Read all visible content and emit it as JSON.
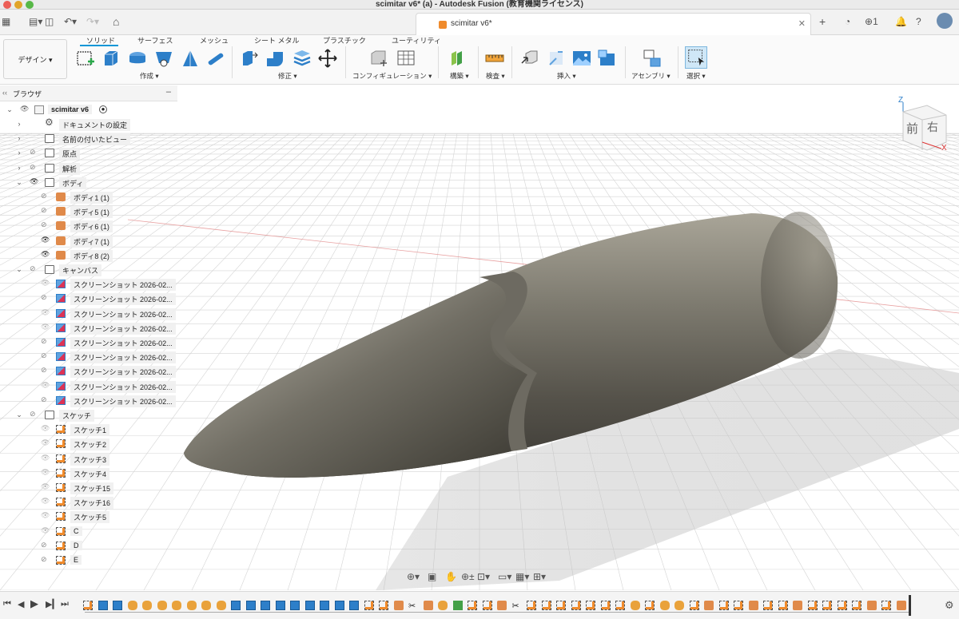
{
  "window": {
    "title": "scimitar v6* (a) - Autodesk Fusion (教育機関ライセンス)",
    "traffic_colors": [
      "#ec5f57",
      "#e1a42a",
      "#57b847"
    ]
  },
  "tabbar": {
    "doc_tab": "scimitar v6*",
    "notifications": "1"
  },
  "toolbar": {
    "workspace": "デザイン ▾",
    "tabs": [
      "ソリッド",
      "サーフェス",
      "メッシュ",
      "シート メタル",
      "プラスチック",
      "ユーティリティ"
    ],
    "groups": {
      "create": "作成 ▾",
      "modify": "修正 ▾",
      "configuration": "コンフィギュレーション ▾",
      "construct": "構築 ▾",
      "inspect": "検査 ▾",
      "insert": "挿入 ▾",
      "assemble": "アセンブリ ▾",
      "select": "選択 ▾"
    }
  },
  "browser": {
    "title": "ブラウザ",
    "root": "scimitar v6",
    "items": [
      {
        "label": "ドキュメントの設定",
        "indent": 1,
        "arrow": "›",
        "icon": "gear"
      },
      {
        "label": "名前の付いたビュー",
        "indent": 1,
        "arrow": "›",
        "icon": "folder"
      },
      {
        "label": "原点",
        "indent": 1,
        "arrow": "›",
        "icon": "folder",
        "eye": "hidden"
      },
      {
        "label": "解析",
        "indent": 1,
        "arrow": "›",
        "icon": "folder",
        "eye": "hidden"
      },
      {
        "label": "ボディ",
        "indent": 1,
        "arrow": "⌄",
        "icon": "folder",
        "eye": "visible"
      },
      {
        "label": "ボディ1 (1)",
        "indent": 2,
        "icon": "body",
        "eye": "hidden"
      },
      {
        "label": "ボディ5 (1)",
        "indent": 2,
        "icon": "body",
        "eye": "hidden"
      },
      {
        "label": "ボディ6 (1)",
        "indent": 2,
        "icon": "body",
        "eye": "hidden"
      },
      {
        "label": "ボディ7 (1)",
        "indent": 2,
        "icon": "body",
        "eye": "visible"
      },
      {
        "label": "ボディ8 (2)",
        "indent": 2,
        "icon": "body",
        "eye": "visible"
      },
      {
        "label": "キャンバス",
        "indent": 1,
        "arrow": "⌄",
        "icon": "folder",
        "eye": "hidden"
      },
      {
        "label": "スクリーンショット 2026-02...",
        "indent": 2,
        "icon": "canvas",
        "eye": "faint"
      },
      {
        "label": "スクリーンショット 2026-02...",
        "indent": 2,
        "icon": "canvas",
        "eye": "hidden"
      },
      {
        "label": "スクリーンショット 2026-02...",
        "indent": 2,
        "icon": "canvas",
        "eye": "faint"
      },
      {
        "label": "スクリーンショット 2026-02...",
        "indent": 2,
        "icon": "canvas",
        "eye": "faint"
      },
      {
        "label": "スクリーンショット 2026-02...",
        "indent": 2,
        "icon": "canvas",
        "eye": "hidden"
      },
      {
        "label": "スクリーンショット 2026-02...",
        "indent": 2,
        "icon": "canvas",
        "eye": "hidden"
      },
      {
        "label": "スクリーンショット 2026-02...",
        "indent": 2,
        "icon": "canvas",
        "eye": "hidden"
      },
      {
        "label": "スクリーンショット 2026-02...",
        "indent": 2,
        "icon": "canvas",
        "eye": "faint"
      },
      {
        "label": "スクリーンショット 2026-02...",
        "indent": 2,
        "icon": "canvas",
        "eye": "hidden"
      },
      {
        "label": "スケッチ",
        "indent": 1,
        "arrow": "⌄",
        "icon": "folder",
        "eye": "hidden"
      },
      {
        "label": "スケッチ1",
        "indent": 2,
        "icon": "sketch-lock",
        "eye": "faint"
      },
      {
        "label": "スケッチ2",
        "indent": 2,
        "icon": "sketch",
        "eye": "faint"
      },
      {
        "label": "スケッチ3",
        "indent": 2,
        "icon": "sketch",
        "eye": "faint"
      },
      {
        "label": "スケッチ4",
        "indent": 2,
        "icon": "sketch",
        "eye": "faint"
      },
      {
        "label": "スケッチ15",
        "indent": 2,
        "icon": "sketch",
        "eye": "faint"
      },
      {
        "label": "スケッチ16",
        "indent": 2,
        "icon": "sketch",
        "eye": "faint"
      },
      {
        "label": "スケッチ5",
        "indent": 2,
        "icon": "sketch",
        "eye": "faint"
      },
      {
        "label": "C",
        "indent": 2,
        "icon": "sketch",
        "eye": "faint"
      },
      {
        "label": "D",
        "indent": 2,
        "icon": "sketch",
        "eye": "hidden"
      },
      {
        "label": "E",
        "indent": 2,
        "icon": "sketch",
        "eye": "hidden"
      }
    ]
  },
  "viewcube": {
    "front": "前",
    "right": "右",
    "z_axis": "Z",
    "x_axis": "X"
  },
  "colors": {
    "accent": "#0696d7",
    "body_orange": "#e08a4a",
    "model_gray": "#8a8578"
  }
}
